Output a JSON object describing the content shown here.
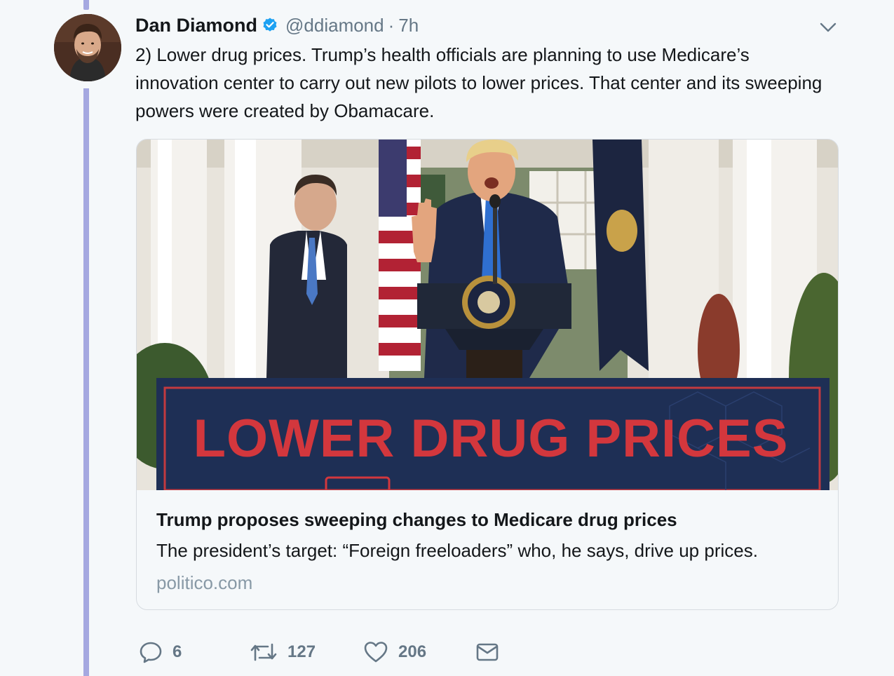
{
  "author": {
    "name": "Dan Diamond",
    "handle": "@ddiamond",
    "separator": "·",
    "time": "7h",
    "verified": true
  },
  "tweet": {
    "text": "2) Lower drug prices. Trump’s health officials are planning to use Medicare’s innovation center to carry out new pilots to lower prices. That center and its sweeping powers were created by Obamacare."
  },
  "card": {
    "image_alt": "Trump at podium, banner reading LOWER DRUG PRICES",
    "banner_text": "LOWER DRUG PRICES",
    "title": "Trump proposes sweeping changes to Medicare drug prices",
    "description": "The president’s target: “Foreign freeloaders” who, he says, drive up prices.",
    "domain": "politico.com"
  },
  "actions": {
    "reply_count": "6",
    "retweet_count": "127",
    "like_count": "206"
  },
  "icons": {
    "verified": "verified-badge-icon",
    "menu": "chevron-down-icon",
    "reply": "reply-icon",
    "retweet": "retweet-icon",
    "like": "heart-icon",
    "dm": "envelope-icon"
  },
  "colors": {
    "thread_line": "#a5a8e0",
    "verified": "#1da1f2",
    "secondary_text": "#657786",
    "banner_blue": "#1e2f55",
    "banner_red": "#d3373d"
  }
}
